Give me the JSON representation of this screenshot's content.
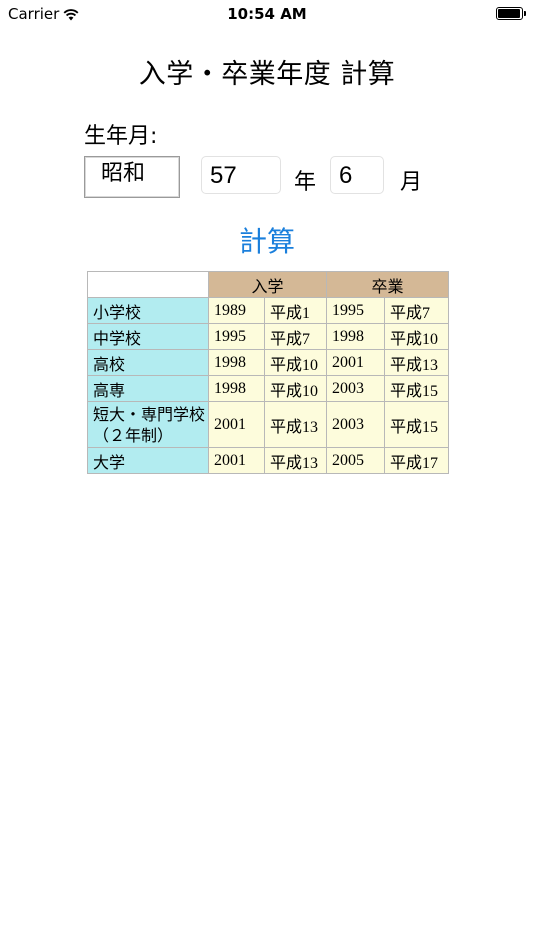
{
  "status_bar": {
    "carrier": "Carrier",
    "time": "10:54 AM"
  },
  "title": "入学・卒業年度 計算",
  "form": {
    "birth_label": "生年月:",
    "era": "昭和",
    "year_value": "57",
    "year_unit": "年",
    "month_value": "6",
    "month_unit": "月"
  },
  "calculate_label": "計算",
  "table": {
    "headers": [
      "",
      "入学",
      "卒業"
    ],
    "rows": [
      {
        "school": "小学校",
        "enter_year": "1989",
        "enter_era": "平成1",
        "grad_year": "1995",
        "grad_era": "平成7"
      },
      {
        "school": "中学校",
        "enter_year": "1995",
        "enter_era": "平成7",
        "grad_year": "1998",
        "grad_era": "平成10"
      },
      {
        "school": "高校",
        "enter_year": "1998",
        "enter_era": "平成10",
        "grad_year": "2001",
        "grad_era": "平成13"
      },
      {
        "school": "高専",
        "enter_year": "1998",
        "enter_era": "平成10",
        "grad_year": "2003",
        "grad_era": "平成15"
      },
      {
        "school": "短大・専門学校（２年制）",
        "enter_year": "2001",
        "enter_era": "平成13",
        "grad_year": "2003",
        "grad_era": "平成15"
      },
      {
        "school": "大学",
        "enter_year": "2001",
        "enter_era": "平成13",
        "grad_year": "2005",
        "grad_era": "平成17"
      }
    ]
  },
  "colors": {
    "accent": "#1a7fdc",
    "header_bg": "#d4b896",
    "school_bg": "#b2ecf0",
    "cell_bg": "#fdfcdc"
  }
}
